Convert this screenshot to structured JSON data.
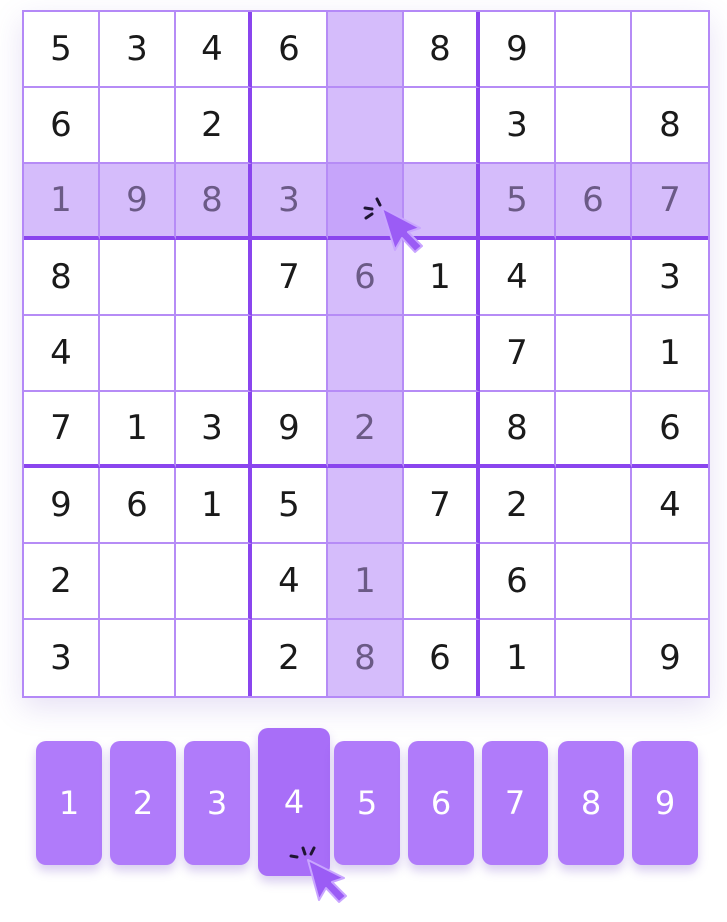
{
  "board": {
    "rows": [
      [
        "5",
        "3",
        "4",
        "6",
        "",
        "8",
        "9",
        "",
        ""
      ],
      [
        "6",
        "",
        "2",
        "",
        "",
        "",
        "3",
        "",
        "8"
      ],
      [
        "1",
        "9",
        "8",
        "3",
        "",
        "",
        "5",
        "6",
        "7"
      ],
      [
        "8",
        "",
        "",
        "7",
        "6",
        "1",
        "4",
        "",
        "3"
      ],
      [
        "4",
        "",
        "",
        "",
        "",
        "",
        "7",
        "",
        "1"
      ],
      [
        "7",
        "1",
        "3",
        "9",
        "2",
        "",
        "8",
        "",
        "6"
      ],
      [
        "9",
        "6",
        "1",
        "5",
        "",
        "7",
        "2",
        "",
        "4"
      ],
      [
        "2",
        "",
        "",
        "4",
        "1",
        "",
        "6",
        "",
        ""
      ],
      [
        "3",
        "",
        "",
        "2",
        "8",
        "6",
        "1",
        "",
        "9"
      ]
    ],
    "highlighted_row": 2,
    "highlighted_col": 4
  },
  "number_pad": {
    "keys": [
      "1",
      "2",
      "3",
      "4",
      "5",
      "6",
      "7",
      "8",
      "9"
    ],
    "active_key": "4"
  },
  "colors": {
    "grid_line": "#b68cf6",
    "box_line": "#8a45ee",
    "highlight": "#d5bcfb",
    "key_bg": "#b07bfa",
    "cursor": "#9b5cf5"
  },
  "icons": {
    "pointer": "hand-pointer-click-icon"
  }
}
